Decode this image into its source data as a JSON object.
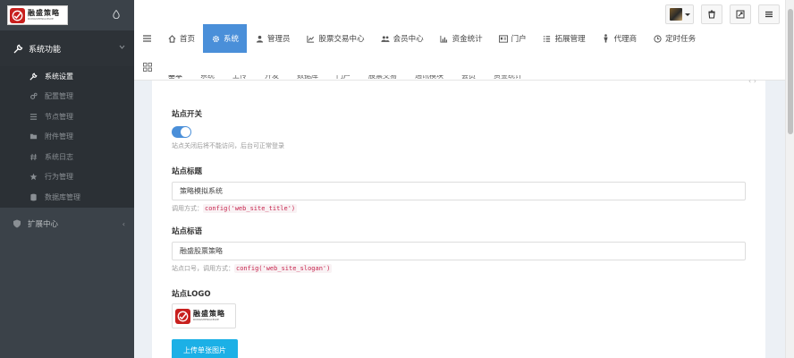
{
  "brand": {
    "name_cn": "融盛策略",
    "name_en": "RONGSHENGCELVE",
    "accent": "#c8201e"
  },
  "sidebar": {
    "group1": {
      "label": "系统功能",
      "icon": "wrench-icon"
    },
    "items": [
      {
        "label": "系统设置",
        "icon": "wrench-icon",
        "active": true
      },
      {
        "label": "配置管理",
        "icon": "gears-icon"
      },
      {
        "label": "节点管理",
        "icon": "list-icon"
      },
      {
        "label": "附件管理",
        "icon": "folder-icon"
      },
      {
        "label": "系统日志",
        "icon": "hashtag-icon"
      },
      {
        "label": "行为管理",
        "icon": "star-icon"
      },
      {
        "label": "数据库管理",
        "icon": "database-icon"
      }
    ],
    "group2": {
      "label": "扩展中心",
      "icon": "shield-icon"
    }
  },
  "header": {
    "tabs": [
      {
        "label": "首页",
        "icon": "home-icon"
      },
      {
        "label": "系统",
        "icon": "gear-icon",
        "active": true
      },
      {
        "label": "管理员",
        "icon": "user-icon"
      },
      {
        "label": "股票交易中心",
        "icon": "line-chart-icon"
      },
      {
        "label": "会员中心",
        "icon": "users-icon"
      },
      {
        "label": "资金统计",
        "icon": "bar-chart-icon"
      },
      {
        "label": "门户",
        "icon": "id-card-icon"
      },
      {
        "label": "拓展管理",
        "icon": "list-icon"
      },
      {
        "label": "代理商",
        "icon": "person-icon"
      },
      {
        "label": "定时任务",
        "icon": "clock-icon"
      }
    ]
  },
  "subtabs": [
    "基本",
    "系统",
    "上传",
    "开发",
    "数据库",
    "门户",
    "股票交易",
    "通讯模块",
    "会员",
    "资金统计"
  ],
  "form": {
    "site_switch": {
      "label": "站点开关",
      "help": "站点关闭后将不能访问，后台可正常登录",
      "value": true
    },
    "site_title": {
      "label": "站点标题",
      "value": "策略模拟系统",
      "help_prefix": "调用方式：",
      "help_code": "config('web_site_title')"
    },
    "site_slogan": {
      "label": "站点标语",
      "value": "融盛股票策略",
      "help_prefix": "站点口号，调用方式：",
      "help_code": "config('web_site_slogan')"
    },
    "site_logo": {
      "label": "站点LOGO",
      "upload_label": "上传单张图片"
    }
  },
  "colors": {
    "sidebar_bg": "#3b4249",
    "active_tab": "#4a8fd9",
    "upload_btn": "#1cb0e6"
  }
}
